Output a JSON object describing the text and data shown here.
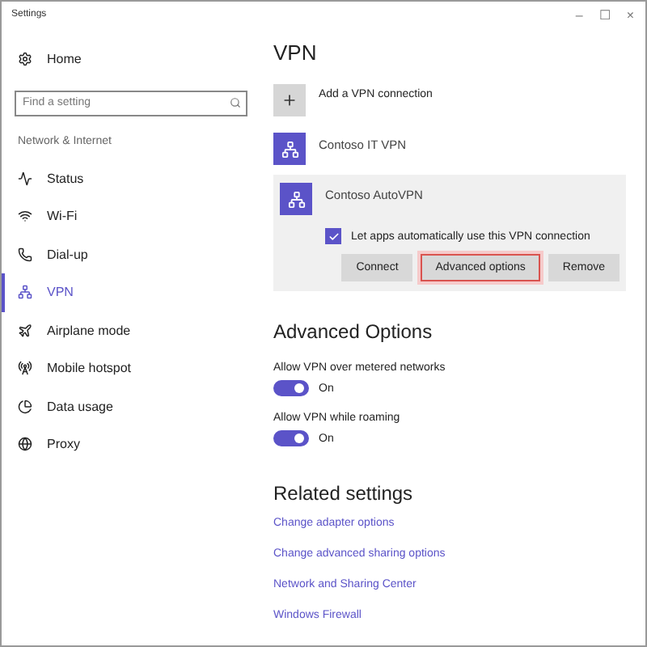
{
  "window": {
    "title": "Settings",
    "controls": [
      "–",
      "☐",
      "×"
    ]
  },
  "sidebar": {
    "home": "Home",
    "search": {
      "placeholder": "Find a setting"
    },
    "section": "Network & Internet",
    "items": [
      {
        "label": "Status",
        "kind": "status",
        "selected": false
      },
      {
        "label": "Wi-Fi",
        "kind": "wifi",
        "selected": false
      },
      {
        "label": "Dial-up",
        "kind": "dialup",
        "selected": false
      },
      {
        "label": "VPN",
        "kind": "vpn",
        "selected": true
      },
      {
        "label": "Airplane mode",
        "kind": "airplane",
        "selected": false
      },
      {
        "label": "Mobile hotspot",
        "kind": "hotspot",
        "selected": false
      },
      {
        "label": "Data usage",
        "kind": "data",
        "selected": false
      },
      {
        "label": "Proxy",
        "kind": "proxy",
        "selected": false
      }
    ]
  },
  "vpn": {
    "title": "VPN",
    "add_label": "Add a VPN connection",
    "connections": [
      {
        "name": "Contoso IT VPN",
        "expanded": false
      },
      {
        "name": "Contoso AutoVPN",
        "expanded": true,
        "auto_label": "Let apps automatically use this VPN connection",
        "auto_checked": true,
        "buttons": [
          {
            "label": "Connect",
            "selected": false
          },
          {
            "label": "Advanced options",
            "selected": true
          },
          {
            "label": "Remove",
            "selected": false
          }
        ]
      }
    ]
  },
  "advanced": {
    "title": "Advanced Options",
    "toggles": [
      {
        "label": "Allow VPN over metered networks",
        "on": true,
        "state": "On"
      },
      {
        "label": "Allow VPN while roaming",
        "on": true,
        "state": "On"
      }
    ]
  },
  "related": {
    "title": "Related settings",
    "links": [
      "Change adapter options",
      "Change advanced sharing options",
      "Network and Sharing Center",
      "Windows Firewall"
    ]
  }
}
